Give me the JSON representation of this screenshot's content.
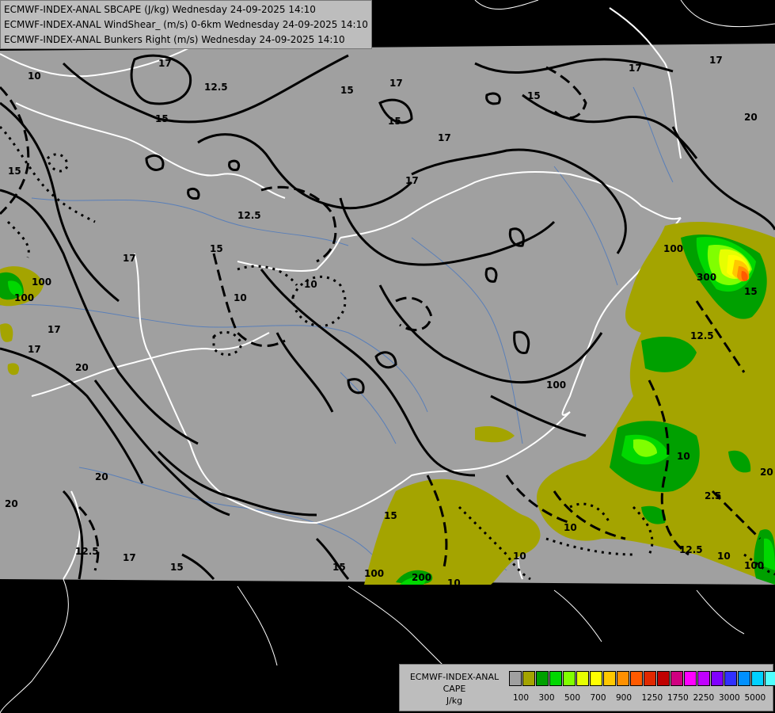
{
  "header": {
    "lines": [
      "ECMWF-INDEX-ANAL SBCAPE (J/kg) Wednesday 24-09-2025 14:10",
      "ECMWF-INDEX-ANAL WindShear_ (m/s) 0-6km Wednesday 24-09-2025 14:10",
      "ECMWF-INDEX-ANAL Bunkers Right (m/s) Wednesday 24-09-2025 14:10"
    ]
  },
  "legend": {
    "name_lines": [
      "ECMWF-INDEX-ANAL",
      "CAPE",
      "J/kg"
    ],
    "colors": [
      "#a0a0a0",
      "#a4a400",
      "#00a000",
      "#00d800",
      "#80ff00",
      "#e6ff00",
      "#ffff00",
      "#ffc800",
      "#ff9000",
      "#ff5a00",
      "#e02800",
      "#c00000",
      "#d00080",
      "#ff00ff",
      "#c000ff",
      "#8000ff",
      "#3030ff",
      "#0090ff",
      "#00d0ff",
      "#50ffff",
      "#c8ffff",
      "#ffffff"
    ],
    "tick_labels": [
      "100",
      "300",
      "500",
      "700",
      "900",
      "1250",
      "1750",
      "2250",
      "3000",
      "5000"
    ]
  },
  "contour_labels": {
    "windshear": [
      "17",
      "12.5",
      "15",
      "15",
      "17",
      "17",
      "15",
      "17",
      "17",
      "20",
      "12.5",
      "15",
      "15",
      "17",
      "17",
      "20",
      "20",
      "15",
      "17",
      "15",
      "12.5",
      "12.5",
      "17",
      "15",
      "15",
      "20",
      "17",
      "2.5",
      "12.5",
      "15",
      "20"
    ],
    "bunkers": [
      "10",
      "10",
      "10",
      "10",
      "10",
      "10",
      "10",
      "10"
    ],
    "cape": [
      "100",
      "100",
      "100",
      "200",
      "100",
      "100",
      "300",
      "100"
    ]
  }
}
